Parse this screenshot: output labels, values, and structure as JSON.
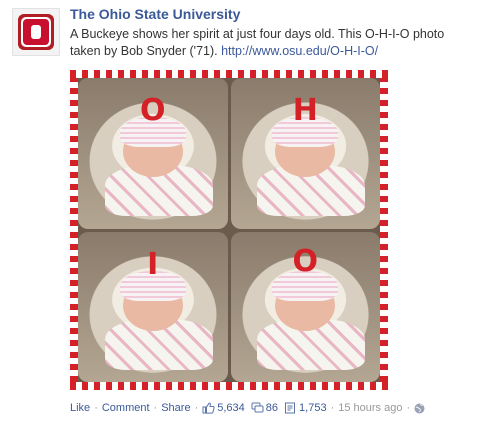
{
  "post": {
    "page_name": "The Ohio State University",
    "text": "A Buckeye shows her spirit at just four days old. This O-H-I-O photo taken by Bob Snyder ('71).",
    "link": "http://www.osu.edu/O-H-I-O/",
    "photo_letters": [
      "O",
      "H",
      "I",
      "O"
    ]
  },
  "actions": {
    "like": "Like",
    "comment": "Comment",
    "share": "Share",
    "like_count": "5,634",
    "comment_count": "86",
    "share_count": "1,753",
    "timestamp": "15 hours ago",
    "audience_icon": "globe-icon"
  },
  "colors": {
    "brand_red": "#d42128",
    "link_blue": "#3b5998"
  }
}
